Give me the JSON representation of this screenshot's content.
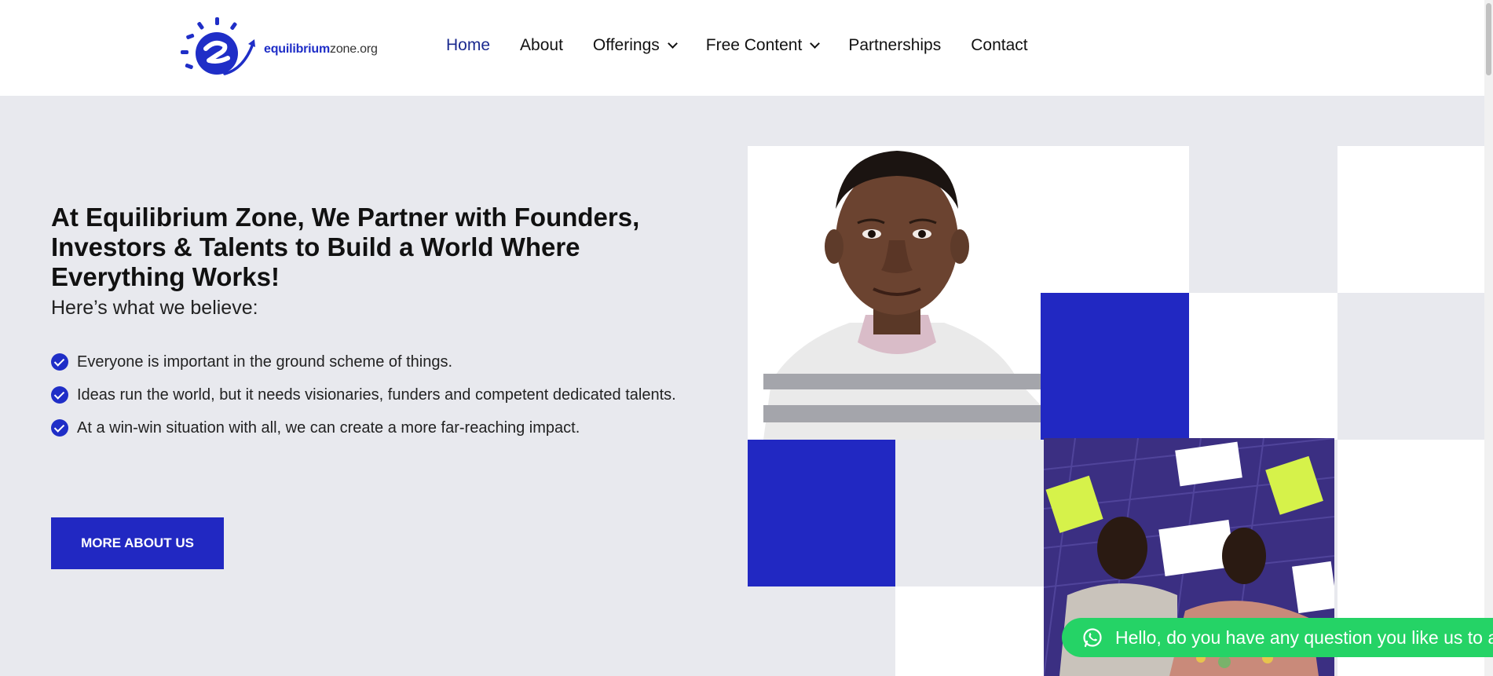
{
  "header": {
    "logo": {
      "brand": "equilibrium",
      "domain": "zone.org",
      "icon": "equilibrium-logo-icon"
    },
    "nav": [
      {
        "label": "Home",
        "active": true
      },
      {
        "label": "About",
        "active": false
      },
      {
        "label": "Offerings",
        "dropdown": true
      },
      {
        "label": "Free Content",
        "dropdown": true
      },
      {
        "label": "Partnerships",
        "active": false
      },
      {
        "label": "Contact",
        "active": false
      }
    ]
  },
  "hero": {
    "title": "At Equilibrium Zone, We Partner with Founders, Investors & Talents to Build a World Where Everything Works!",
    "subtitle": "Here’s what we believe:",
    "beliefs": [
      "Everyone is important in the ground scheme of things.",
      "Ideas run the world, but it needs visionaries, funders and competent dedicated talents.",
      "At a win-win situation with all, we can create a more far-reaching impact."
    ],
    "cta_label": "MORE ABOUT US"
  },
  "whatsapp": {
    "message": "Hello, do you have any question you like us to answer?",
    "icon": "whatsapp-icon"
  },
  "colors": {
    "accent": "#2128c2",
    "page_background": "#e8e9ee",
    "whatsapp_green": "#25d366",
    "nav_active": "#1b2a8f"
  }
}
